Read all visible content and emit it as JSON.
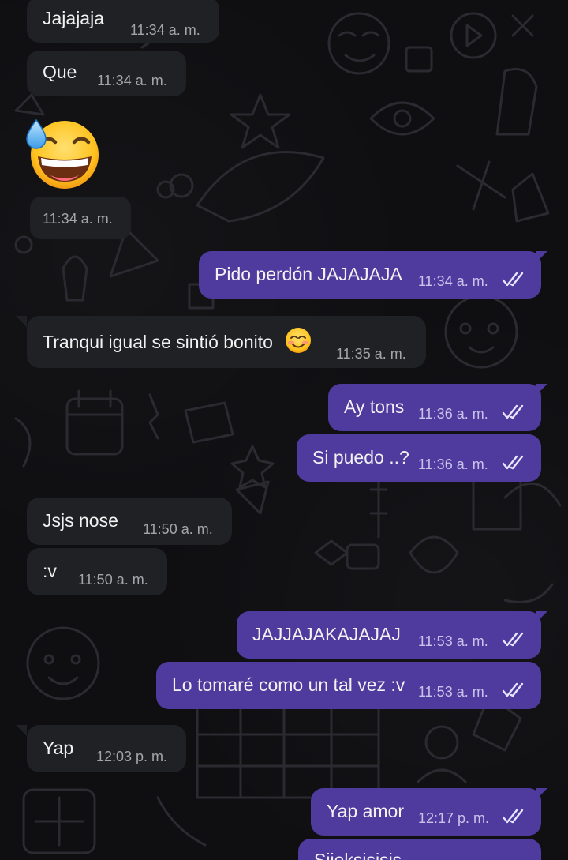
{
  "messages": [
    {
      "text": "Jajajaja",
      "time": "11:34 a. m."
    },
    {
      "text": "Que",
      "time": "11:34 a. m."
    },
    {
      "emoji": "grinning-face-with-sweat",
      "time": "11:34 a. m."
    },
    {
      "text": "Pido perdón JAJAJAJA",
      "time": "11:34 a. m.",
      "status": "read"
    },
    {
      "text": "Tranqui igual se sintió bonito",
      "emoji": "smiling-face-with-smiling-eyes",
      "time": "11:35 a. m."
    },
    {
      "text": "Ay tons",
      "time": "11:36 a. m.",
      "status": "read"
    },
    {
      "text": "Si puedo ..?",
      "time": "11:36 a. m.",
      "status": "read"
    },
    {
      "text": "Jsjs nose",
      "time": "11:50 a. m."
    },
    {
      "text": ":v",
      "time": "11:50 a. m."
    },
    {
      "text": "JAJJAJAKAJAJAJ",
      "time": "11:53 a. m.",
      "status": "read"
    },
    {
      "text": "Lo tomaré como un tal vez :v",
      "time": "11:53 a. m.",
      "status": "read"
    },
    {
      "text": "Yap",
      "time": "12:03 p. m."
    },
    {
      "text": "Yap amor",
      "time": "12:17 p. m.",
      "status": "read"
    },
    {
      "text": "Sjjeksjsjsjs"
    }
  ],
  "colors": {
    "outgoing_bubble": "#4f3a9e",
    "incoming_bubble": "#1f2124",
    "background": "#0f0f12"
  }
}
